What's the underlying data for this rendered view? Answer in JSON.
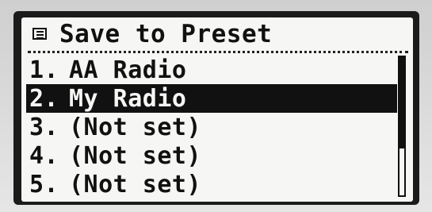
{
  "header": {
    "icon": "menu-list-icon",
    "title": "Save to Preset"
  },
  "presets": [
    {
      "number": "1.",
      "name": "AA Radio",
      "selected": false
    },
    {
      "number": "2.",
      "name": "My Radio",
      "selected": true
    },
    {
      "number": "3.",
      "name": "(Not set)",
      "selected": false
    },
    {
      "number": "4.",
      "name": "(Not set)",
      "selected": false
    },
    {
      "number": "5.",
      "name": "(Not set)",
      "selected": false
    }
  ],
  "scroll": {
    "visible_fraction": 0.66,
    "position_fraction": 0.0
  },
  "colors": {
    "screen_background": "#f6f6f4",
    "foreground": "#111111",
    "bezel": "#1b1b1b"
  }
}
